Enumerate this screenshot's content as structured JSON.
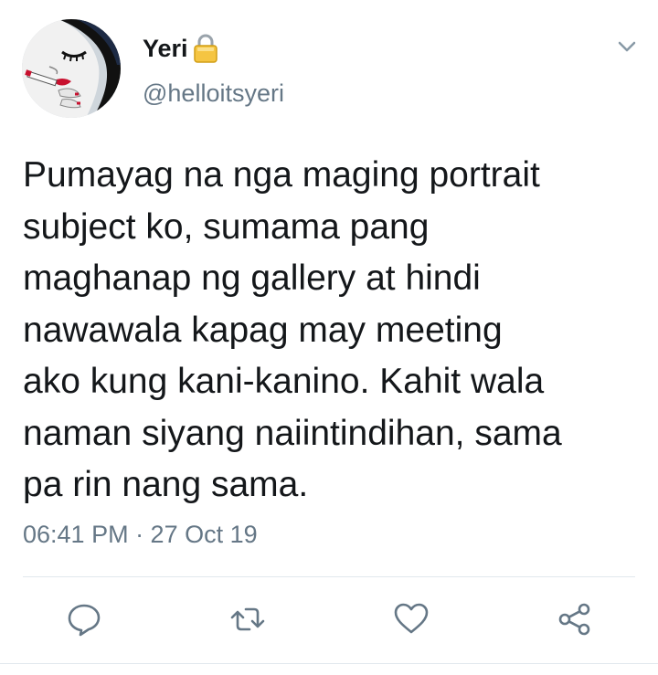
{
  "user": {
    "display_name": "Yeri",
    "handle": "@helloitsyeri",
    "protected_icon": "lock-icon",
    "avatar": "avatar-illustration"
  },
  "tweet": {
    "text": "Pumayag na nga maging portrait\nsubject ko, sumama pang\nmaghanap ng gallery at hindi\nnawawala kapag may meeting\nako kung kani-kanino. Kahit wala\nnaman siyang naiintindihan, sama\npa rin nang sama.",
    "timestamp": "06:41 PM · 27 Oct 19"
  },
  "actions": [
    {
      "name": "reply",
      "icon": "reply-icon"
    },
    {
      "name": "retweet",
      "icon": "retweet-icon"
    },
    {
      "name": "like",
      "icon": "heart-icon"
    },
    {
      "name": "share",
      "icon": "share-icon"
    }
  ],
  "colors": {
    "text": "#14171a",
    "secondary": "#657786",
    "divider": "#e1e8ed",
    "icon": "#657786",
    "lock": "#e6b422"
  }
}
